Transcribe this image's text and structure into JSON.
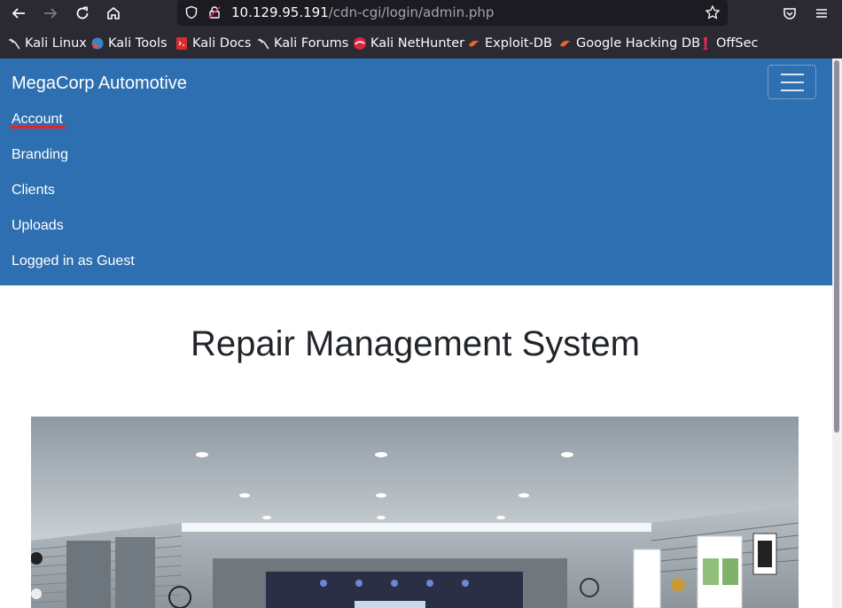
{
  "browser": {
    "url_host": "10.129.95.191",
    "url_path": "/cdn-cgi/login/admin.php",
    "bookmarks": [
      {
        "label": "Kali Linux",
        "icon": "kali-dragon-icon"
      },
      {
        "label": "Kali Tools",
        "icon": "kali-tools-icon"
      },
      {
        "label": "Kali Docs",
        "icon": "kali-docs-icon"
      },
      {
        "label": "Kali Forums",
        "icon": "kali-dragon-icon"
      },
      {
        "label": "Kali NetHunter",
        "icon": "nethunter-icon"
      },
      {
        "label": "Exploit-DB",
        "icon": "exploit-db-icon"
      },
      {
        "label": "Google Hacking DB",
        "icon": "exploit-db-icon"
      },
      {
        "label": "OffSec",
        "icon": "offsec-icon"
      }
    ]
  },
  "navbar": {
    "brand": "MegaCorp Automotive",
    "links": [
      "Account",
      "Branding",
      "Clients",
      "Uploads",
      "Logged in as Guest"
    ]
  },
  "main": {
    "title": "Repair Management System"
  },
  "colors": {
    "navbar_bg": "#2d6fb0",
    "browser_chrome": "#2b2a33",
    "active_underline": "#e3242b"
  }
}
